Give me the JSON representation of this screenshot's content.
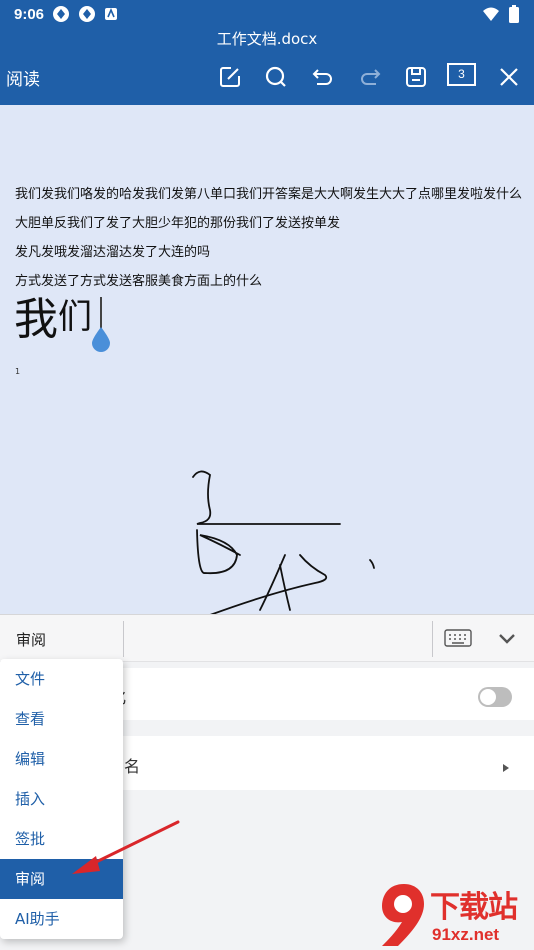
{
  "status_bar": {
    "time": "9:06"
  },
  "document": {
    "filename": "工作文档.docx",
    "mode_label": "阅读",
    "page_count": "3",
    "lines": [
      "我们发我们咯发的哈发我们发第八单口我们开答案是大大啊发生大大了点哪里发啦发什么",
      "大胆单反我们了发了大胆少年犯的那份我们了发送按单发",
      "发凡发哦发溜达溜达发了大连的吗",
      "方式发送了方式发送客服美食方面上的什么"
    ],
    "big_text_1": "我",
    "big_text_2": "们",
    "page_number": "1"
  },
  "review_bar": {
    "label": "审阅"
  },
  "panel": {
    "row1_partial": "化",
    "row2_partial": "名",
    "toggle_on": false
  },
  "menu": {
    "items": [
      "文件",
      "查看",
      "编辑",
      "插入",
      "签批",
      "审阅",
      "AI助手"
    ],
    "active_index": 5
  },
  "watermark": {
    "title": "下载站",
    "url": "91xz.net"
  },
  "colors": {
    "primary": "#1f5fa8",
    "doc_bg": "#dfe7f7",
    "annotation": "#d9262a"
  }
}
